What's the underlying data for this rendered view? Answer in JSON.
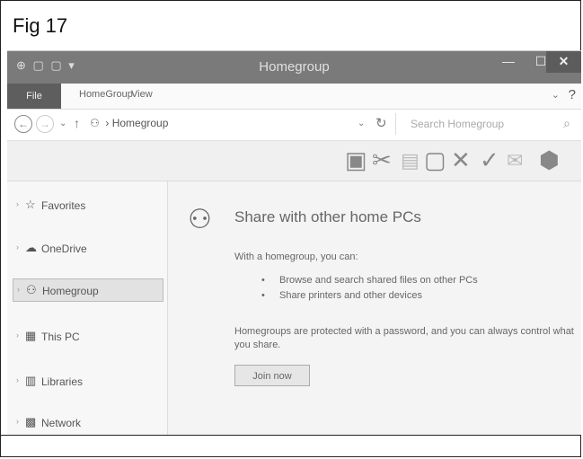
{
  "figure_label": "Fig 17",
  "window": {
    "title": "Homegroup",
    "quick_access": "⊕ ▢ ▢ ▾",
    "minimize": "—",
    "maximize": "☐",
    "close": "✕"
  },
  "ribbon": {
    "tabs": [
      {
        "label": "File"
      },
      {
        "label": "HomeGroup"
      },
      {
        "label": "View"
      }
    ],
    "expand": "⌄",
    "help": "?"
  },
  "address": {
    "back": "←",
    "forward": "→",
    "recent": "⌄",
    "up": "↑",
    "breadcrumb": "Homegroup",
    "dropdown": "⌄",
    "refresh": "↻",
    "search_placeholder": "Search Homegroup",
    "search_icon": "⌕"
  },
  "toolbar": {
    "icons": [
      {
        "name": "preview-pane-icon",
        "glyph": "▣"
      },
      {
        "name": "cut-icon",
        "glyph": "✂"
      },
      {
        "name": "copy-icon",
        "glyph": "▤"
      },
      {
        "name": "paste-icon",
        "glyph": "▢"
      },
      {
        "name": "delete-icon",
        "glyph": "✕"
      },
      {
        "name": "check-icon",
        "glyph": "✓"
      },
      {
        "name": "mail-icon",
        "glyph": "✉"
      },
      {
        "name": "settings-icon",
        "glyph": "⬢"
      }
    ]
  },
  "sidebar": {
    "items": [
      {
        "label": "Favorites",
        "icon": "☆"
      },
      {
        "label": "OneDrive",
        "icon": "☁"
      },
      {
        "label": "Homegroup",
        "icon": "⚇"
      },
      {
        "label": "This PC",
        "icon": "▦"
      },
      {
        "label": "Libraries",
        "icon": "▥"
      },
      {
        "label": "Network",
        "icon": "▩"
      }
    ],
    "expand_arrow": "›"
  },
  "main": {
    "icon": "⚇",
    "heading": "Share with other home PCs",
    "intro": "With a homegroup, you can:",
    "bullets": [
      "Browse and search shared files on other PCs",
      "Share printers and other devices"
    ],
    "protect_text": "Homegroups are protected with a password, and you can always control what you share.",
    "join_button": "Join now"
  }
}
